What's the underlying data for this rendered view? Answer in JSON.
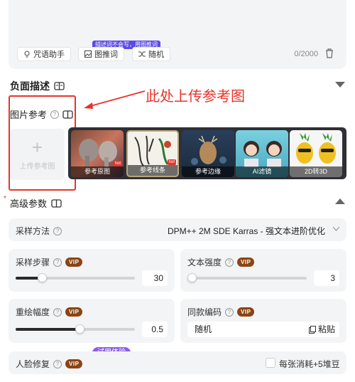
{
  "prompt": {
    "buttons": [
      {
        "icon": "lightbulb-icon",
        "label": "咒语助手"
      },
      {
        "icon": "image-icon",
        "label": "图推词"
      },
      {
        "icon": "shuffle-icon",
        "label": "随机"
      }
    ],
    "tooltip": "描述词不会写，用图推词",
    "counter": "0/2000"
  },
  "negative": {
    "title": "负面描述"
  },
  "annotation": "此处上传参考图",
  "reference": {
    "label": "图片参考",
    "upload_label": "上传参考图",
    "thumbs": [
      {
        "caption": "参考原图",
        "hot": "hot"
      },
      {
        "caption": "参考线条",
        "hot": "hot"
      },
      {
        "caption": "参考边缘"
      },
      {
        "caption": "AI滤镜"
      },
      {
        "caption": "2D转3D"
      }
    ]
  },
  "advanced": {
    "title": "高级参数",
    "sampler": {
      "label": "采样方法",
      "value": "DPM++ 2M SDE Karras - 强文本进阶优化"
    },
    "steps": {
      "label": "采样步骤",
      "value": "30",
      "level": 0.2
    },
    "cfg": {
      "label": "文本强度",
      "value": "3",
      "level": 0.0
    },
    "denoise": {
      "label": "重绘幅度",
      "value": "0.5",
      "level": 0.5
    },
    "seed": {
      "label": "同款编码",
      "value": "随机",
      "paste": "粘贴"
    },
    "face": {
      "label": "人脸修复",
      "badge": "试用体验",
      "cost": "每张消耗+5堆豆"
    },
    "vip": "VIP"
  },
  "colors": {
    "accent": "#e8332a",
    "vip": "#8b4413",
    "badge": "#8c5ce8"
  }
}
